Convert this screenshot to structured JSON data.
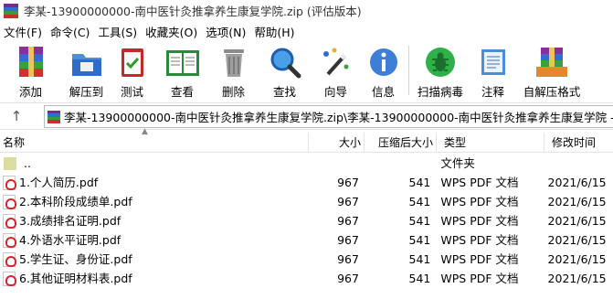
{
  "window": {
    "title": "李某-13900000000-南中医针灸推拿养生康复学院.zip (评估版本)"
  },
  "menu": [
    "文件(F)",
    "命令(C)",
    "工具(S)",
    "收藏夹(O)",
    "选项(N)",
    "帮助(H)"
  ],
  "toolbar": {
    "add": "添加",
    "extract": "解压到",
    "test": "测试",
    "view": "查看",
    "delete": "删除",
    "find": "查找",
    "wizard": "向导",
    "info": "信息",
    "virus_scan": "扫描病毒",
    "comment": "注释",
    "sfx": "自解压格式"
  },
  "address": {
    "path": "李某-13900000000-南中医针灸推拿养生康复学院.zip\\李某-13900000000-南中医针灸推拿养生康复学院 - ZIP 压缩文件"
  },
  "columns": {
    "name": "名称",
    "size": "大小",
    "compressed": "压缩后大小",
    "type": "类型",
    "modified": "修改时间"
  },
  "parent_row": {
    "name": "..",
    "type": "文件夹"
  },
  "files": [
    {
      "name": "1.个人简历.pdf",
      "size": "967",
      "compressed": "541",
      "type": "WPS PDF 文档",
      "modified": "2021/6/15"
    },
    {
      "name": "2.本科阶段成绩单.pdf",
      "size": "967",
      "compressed": "541",
      "type": "WPS PDF 文档",
      "modified": "2021/6/15"
    },
    {
      "name": "3.成绩排名证明.pdf",
      "size": "967",
      "compressed": "541",
      "type": "WPS PDF 文档",
      "modified": "2021/6/15"
    },
    {
      "name": "4.外语水平证明.pdf",
      "size": "967",
      "compressed": "541",
      "type": "WPS PDF 文档",
      "modified": "2021/6/15"
    },
    {
      "name": "5.学生证、身份证.pdf",
      "size": "967",
      "compressed": "541",
      "type": "WPS PDF 文档",
      "modified": "2021/6/15"
    },
    {
      "name": "6.其他证明材料表.pdf",
      "size": "967",
      "compressed": "541",
      "type": "WPS PDF 文档",
      "modified": "2021/6/15"
    }
  ],
  "icons": {
    "app": "winrar-books-icon",
    "up": "up-arrow-icon",
    "pdf": "pdf-file-icon",
    "folder": "folder-up-icon"
  }
}
